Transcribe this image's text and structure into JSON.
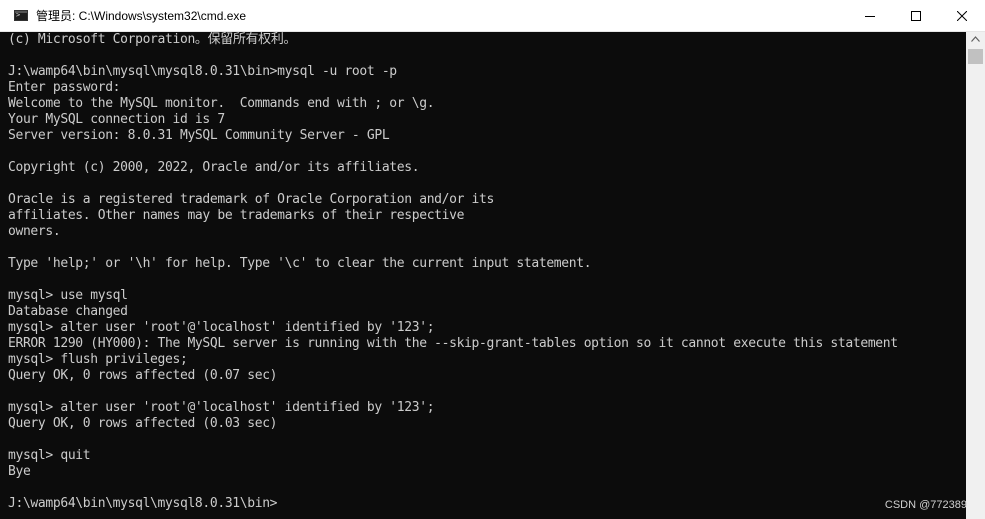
{
  "window": {
    "title": "管理员: C:\\Windows\\system32\\cmd.exe",
    "icon": "console-icon",
    "controls": [
      "minimize-icon",
      "maximize-icon",
      "close-icon"
    ]
  },
  "console": {
    "lines": [
      "(c) Microsoft Corporation。保留所有权利。",
      "",
      "J:\\wamp64\\bin\\mysql\\mysql8.0.31\\bin>mysql -u root -p",
      "Enter password:",
      "Welcome to the MySQL monitor.  Commands end with ; or \\g.",
      "Your MySQL connection id is 7",
      "Server version: 8.0.31 MySQL Community Server - GPL",
      "",
      "Copyright (c) 2000, 2022, Oracle and/or its affiliates.",
      "",
      "Oracle is a registered trademark of Oracle Corporation and/or its",
      "affiliates. Other names may be trademarks of their respective",
      "owners.",
      "",
      "Type 'help;' or '\\h' for help. Type '\\c' to clear the current input statement.",
      "",
      "mysql> use mysql",
      "Database changed",
      "mysql> alter user 'root'@'localhost' identified by '123';",
      "ERROR 1290 (HY000): The MySQL server is running with the --skip-grant-tables option so it cannot execute this statement",
      "mysql> flush privileges;",
      "Query OK, 0 rows affected (0.07 sec)",
      "",
      "mysql> alter user 'root'@'localhost' identified by '123';",
      "Query OK, 0 rows affected (0.03 sec)",
      "",
      "mysql> quit",
      "Bye",
      "",
      "J:\\wamp64\\bin\\mysql\\mysql8.0.31\\bin>"
    ]
  },
  "watermark": "CSDN @772389",
  "colors": {
    "console_background": "#0c0c0c",
    "console_text": "#cccccc",
    "titlebar": "#ffffff"
  }
}
